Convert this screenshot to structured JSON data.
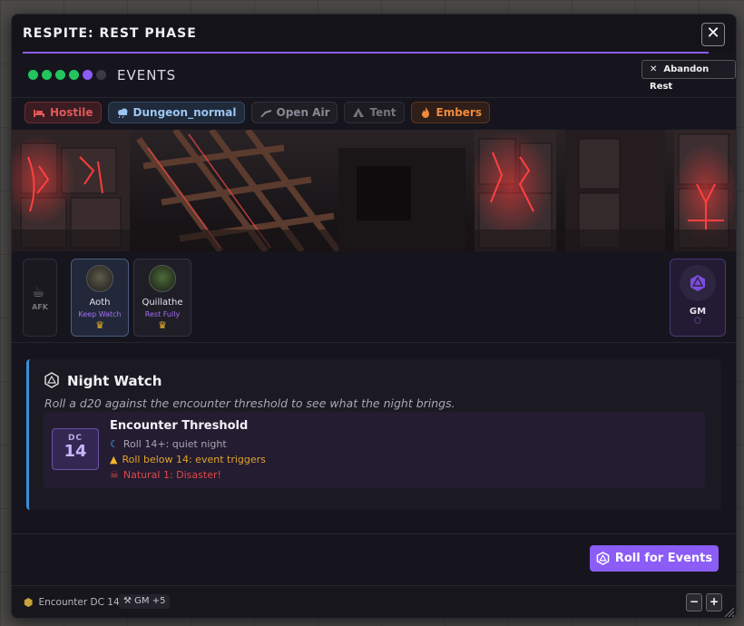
{
  "window": {
    "title": "RESPITE: REST PHASE",
    "close_label": "✕"
  },
  "phase": {
    "label": "EVENTS",
    "dots": [
      "#22c55e",
      "#22c55e",
      "#22c55e",
      "#22c55e",
      "#8b5cf6",
      "#3b3946"
    ],
    "abandon_label": "Abandon Rest",
    "abandon_icon": "✕"
  },
  "tags": [
    {
      "label": "Hostile",
      "icon": "bed-icon",
      "color": "#e05858",
      "bg": "#3a1c22",
      "border": "#6b2c34"
    },
    {
      "label": "Dungeon_normal",
      "icon": "cloud-icon",
      "color": "#9cc4f0",
      "bg": "#1f2a3a",
      "border": "#33465f"
    },
    {
      "label": "Open Air",
      "icon": "shelter-icon",
      "color": "#8a8794",
      "bg": "#1f1e25",
      "border": "#33323b"
    },
    {
      "label": "Tent",
      "icon": "tent-icon",
      "color": "#77747f",
      "bg": "#1c1b21",
      "border": "#302f37"
    },
    {
      "label": "Embers",
      "icon": "fire-icon",
      "color": "#f08a3c",
      "bg": "#2f1f18",
      "border": "#5a3521"
    }
  ],
  "party": {
    "afk_label": "AFK",
    "members": [
      {
        "name": "Aoth",
        "status": "Keep Watch",
        "active": true
      },
      {
        "name": "Quillathe",
        "status": "Rest Fully",
        "active": false
      }
    ],
    "gm_label": "GM"
  },
  "event": {
    "title": "Night Watch",
    "description": "Roll a d20 against the encounter threshold to see what the night brings.",
    "threshold": {
      "dc_label": "DC",
      "dc_value": "14",
      "title": "Encounter Threshold",
      "lines": [
        {
          "text": "Roll 14+: quiet night",
          "icon": "moon-icon",
          "color": "#a8a5b4",
          "icon_color": "#4da3ff"
        },
        {
          "text": "Roll below 14: event triggers",
          "icon": "warning-icon",
          "color": "#e2a32c",
          "icon_color": "#f5b52a"
        },
        {
          "text": "Natural 1: Disaster!",
          "icon": "skull-icon",
          "color": "#e04848",
          "icon_color": "#e04848"
        }
      ]
    }
  },
  "actions": {
    "roll_label": "Roll for Events"
  },
  "status": {
    "encounter": "Encounter DC 14",
    "gm_modifier": "GM +5",
    "zoom_out": "−",
    "zoom_in": "+"
  }
}
